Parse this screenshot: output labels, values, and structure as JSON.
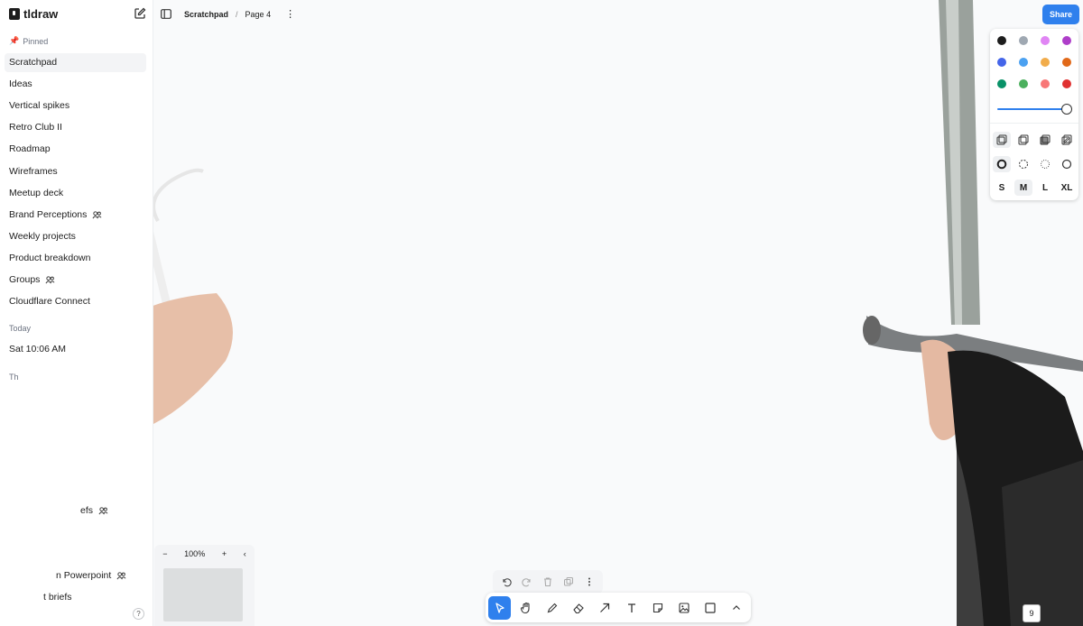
{
  "app": {
    "logo_text": "tldraw"
  },
  "sidebar": {
    "pinned_label": "Pinned",
    "pinned": [
      {
        "label": "Scratchpad",
        "active": true,
        "shared": false
      },
      {
        "label": "Ideas",
        "shared": false
      },
      {
        "label": "Vertical spikes",
        "shared": false
      },
      {
        "label": "Retro Club II",
        "shared": false
      },
      {
        "label": "Roadmap",
        "shared": false
      },
      {
        "label": "Wireframes",
        "shared": false
      },
      {
        "label": "Meetup deck",
        "shared": false
      },
      {
        "label": "Brand Perceptions",
        "shared": true
      },
      {
        "label": "Weekly projects",
        "shared": false
      },
      {
        "label": "Product breakdown",
        "shared": false
      },
      {
        "label": "Groups",
        "shared": true
      },
      {
        "label": "Cloudflare Connect",
        "shared": false
      }
    ],
    "today_label": "Today",
    "today": [
      {
        "label": "Sat 10:06 AM"
      }
    ],
    "partial_section_label": "Th",
    "partial_items": [
      {
        "label": "efs",
        "shared": true
      },
      {
        "label": "n Powerpoint",
        "shared": true
      },
      {
        "label": "t briefs",
        "shared": false
      }
    ],
    "help_label": "?"
  },
  "topbar": {
    "file": "Scratchpad",
    "separator": "/",
    "page": "Page 4",
    "more": "⋮",
    "share_label": "Share"
  },
  "style_panel": {
    "colors": [
      "#1d1d1d",
      "#9fa8b2",
      "#e085f4",
      "#ae3ec9",
      "#4465e9",
      "#4ba1f1",
      "#f1ac4b",
      "#e16919",
      "#099268",
      "#4cb05e",
      "#f87777",
      "#e03131"
    ],
    "opacity": 1.0,
    "sizes": [
      "S",
      "M",
      "L",
      "XL"
    ],
    "selected_size": "M"
  },
  "minimap": {
    "zoom_out": "−",
    "zoom_level": "100%",
    "zoom_in": "+",
    "collapse": "‹"
  },
  "toolbar": {
    "tools": [
      "select-tool",
      "hand-tool",
      "draw-tool",
      "eraser-tool",
      "arrow-tool",
      "text-tool",
      "note-tool",
      "image-tool",
      "rectangle-tool",
      "more-tools"
    ],
    "selected": "select-tool"
  },
  "corner_label": "9"
}
